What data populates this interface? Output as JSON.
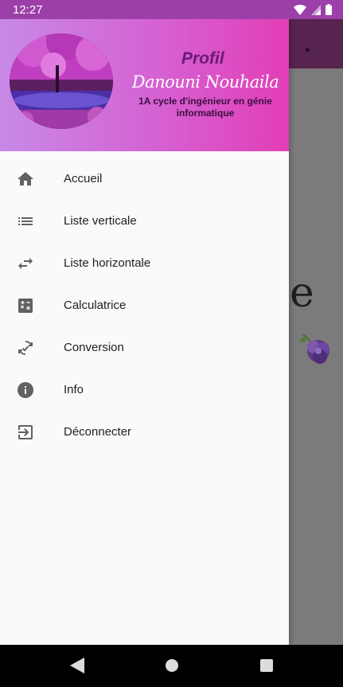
{
  "status_bar": {
    "time": "12:27"
  },
  "background": {
    "text_fragment": "e"
  },
  "drawer": {
    "header": {
      "title": "Profil",
      "name": "Danouni Nouhaila",
      "subtitle": "1A cycle d'ingénieur en génie informatique"
    },
    "items": [
      {
        "label": "Accueil",
        "icon": "home-icon"
      },
      {
        "label": "Liste verticale",
        "icon": "list-icon"
      },
      {
        "label": "Liste horizontale",
        "icon": "swap-horiz-icon"
      },
      {
        "label": "Calculatrice",
        "icon": "calculator-icon"
      },
      {
        "label": "Conversion",
        "icon": "sync-check-icon"
      },
      {
        "label": "Info",
        "icon": "info-icon"
      },
      {
        "label": "Déconnecter",
        "icon": "logout-icon"
      }
    ]
  },
  "colors": {
    "status_bar": "#9c3fa8",
    "header_gradient_start": "#c889e6",
    "header_gradient_end": "#e23eb6",
    "title_color": "#6b1a78",
    "toolbar_dim": "#57234f"
  }
}
